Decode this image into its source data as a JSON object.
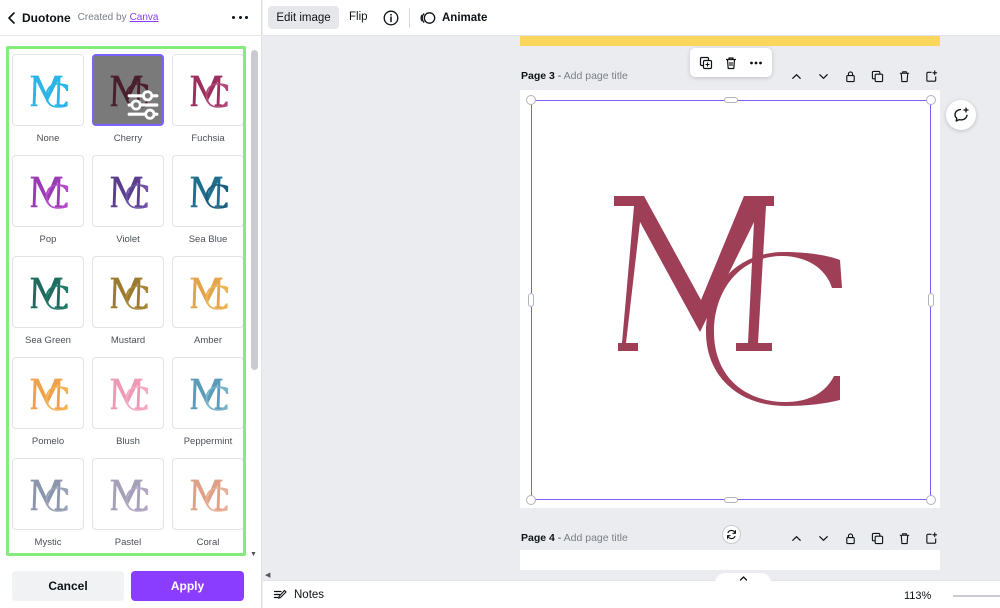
{
  "panel": {
    "title": "Duotone",
    "created_by": "Created by",
    "creator_link": "Canva",
    "filters": [
      {
        "label": "None",
        "c1": "#2bb5e6",
        "c2": "#2bb5e6",
        "selected": false
      },
      {
        "label": "Cherry",
        "c1": "#4a1f2d",
        "c2": "#4a1f2d",
        "selected": true
      },
      {
        "label": "Fuchsia",
        "c1": "#9c2f5d",
        "c2": "#b24a78",
        "selected": false
      },
      {
        "label": "Pop",
        "c1": "#9b3ab5",
        "c2": "#b44cc9",
        "selected": false
      },
      {
        "label": "Violet",
        "c1": "#5b3e8f",
        "c2": "#6f53a6",
        "selected": false
      },
      {
        "label": "Sea Blue",
        "c1": "#1f6f8e",
        "c2": "#1d5c7a",
        "selected": false
      },
      {
        "label": "Sea Green",
        "c1": "#1f6b5e",
        "c2": "#217a66",
        "selected": false
      },
      {
        "label": "Mustard",
        "c1": "#9a7a2e",
        "c2": "#a8853a",
        "selected": false
      },
      {
        "label": "Amber",
        "c1": "#e3a44a",
        "c2": "#ecb358",
        "selected": false
      },
      {
        "label": "Pomelo",
        "c1": "#f0a24a",
        "c2": "#f2b454",
        "selected": false
      },
      {
        "label": "Blush",
        "c1": "#ee9ab6",
        "c2": "#f3aac2",
        "selected": false
      },
      {
        "label": "Peppermint",
        "c1": "#5b9cb8",
        "c2": "#7ab3c8",
        "selected": false
      },
      {
        "label": "Mystic",
        "c1": "#8b95ab",
        "c2": "#9aa3b8",
        "selected": false
      },
      {
        "label": "Pastel",
        "c1": "#a5a0b8",
        "c2": "#b2a8c4",
        "selected": false
      },
      {
        "label": "Coral",
        "c1": "#e0a088",
        "c2": "#e8b098",
        "selected": false
      }
    ],
    "cancel_label": "Cancel",
    "apply_label": "Apply"
  },
  "toolbar": {
    "edit_image_label": "Edit image",
    "flip_label": "Flip",
    "animate_label": "Animate"
  },
  "pages": {
    "page3": {
      "label": "Page 3",
      "separator": " - ",
      "subtitle": "Add page title"
    },
    "page4": {
      "label": "Page 4",
      "separator": " - ",
      "subtitle": "Add page title"
    }
  },
  "canvas": {
    "logo_color": "#9e3f57"
  },
  "footer": {
    "notes_label": "Notes",
    "zoom_level": "113%"
  },
  "colors": {
    "accent": "#8b3dff",
    "selection": "#7d5cf5",
    "highlight_frame": "#84ec7a"
  }
}
